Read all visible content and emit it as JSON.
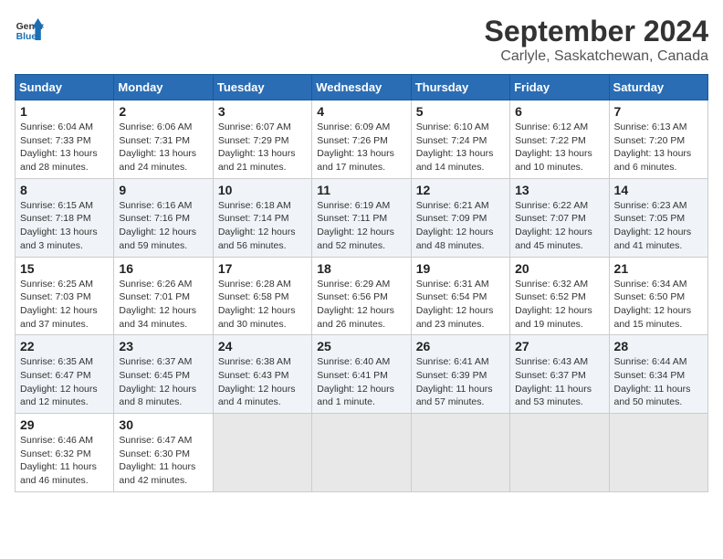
{
  "header": {
    "logo_line1": "General",
    "logo_line2": "Blue",
    "month_year": "September 2024",
    "location": "Carlyle, Saskatchewan, Canada"
  },
  "days_of_week": [
    "Sunday",
    "Monday",
    "Tuesday",
    "Wednesday",
    "Thursday",
    "Friday",
    "Saturday"
  ],
  "weeks": [
    [
      {
        "day": "1",
        "sunrise": "Sunrise: 6:04 AM",
        "sunset": "Sunset: 7:33 PM",
        "daylight": "Daylight: 13 hours and 28 minutes."
      },
      {
        "day": "2",
        "sunrise": "Sunrise: 6:06 AM",
        "sunset": "Sunset: 7:31 PM",
        "daylight": "Daylight: 13 hours and 24 minutes."
      },
      {
        "day": "3",
        "sunrise": "Sunrise: 6:07 AM",
        "sunset": "Sunset: 7:29 PM",
        "daylight": "Daylight: 13 hours and 21 minutes."
      },
      {
        "day": "4",
        "sunrise": "Sunrise: 6:09 AM",
        "sunset": "Sunset: 7:26 PM",
        "daylight": "Daylight: 13 hours and 17 minutes."
      },
      {
        "day": "5",
        "sunrise": "Sunrise: 6:10 AM",
        "sunset": "Sunset: 7:24 PM",
        "daylight": "Daylight: 13 hours and 14 minutes."
      },
      {
        "day": "6",
        "sunrise": "Sunrise: 6:12 AM",
        "sunset": "Sunset: 7:22 PM",
        "daylight": "Daylight: 13 hours and 10 minutes."
      },
      {
        "day": "7",
        "sunrise": "Sunrise: 6:13 AM",
        "sunset": "Sunset: 7:20 PM",
        "daylight": "Daylight: 13 hours and 6 minutes."
      }
    ],
    [
      {
        "day": "8",
        "sunrise": "Sunrise: 6:15 AM",
        "sunset": "Sunset: 7:18 PM",
        "daylight": "Daylight: 13 hours and 3 minutes."
      },
      {
        "day": "9",
        "sunrise": "Sunrise: 6:16 AM",
        "sunset": "Sunset: 7:16 PM",
        "daylight": "Daylight: 12 hours and 59 minutes."
      },
      {
        "day": "10",
        "sunrise": "Sunrise: 6:18 AM",
        "sunset": "Sunset: 7:14 PM",
        "daylight": "Daylight: 12 hours and 56 minutes."
      },
      {
        "day": "11",
        "sunrise": "Sunrise: 6:19 AM",
        "sunset": "Sunset: 7:11 PM",
        "daylight": "Daylight: 12 hours and 52 minutes."
      },
      {
        "day": "12",
        "sunrise": "Sunrise: 6:21 AM",
        "sunset": "Sunset: 7:09 PM",
        "daylight": "Daylight: 12 hours and 48 minutes."
      },
      {
        "day": "13",
        "sunrise": "Sunrise: 6:22 AM",
        "sunset": "Sunset: 7:07 PM",
        "daylight": "Daylight: 12 hours and 45 minutes."
      },
      {
        "day": "14",
        "sunrise": "Sunrise: 6:23 AM",
        "sunset": "Sunset: 7:05 PM",
        "daylight": "Daylight: 12 hours and 41 minutes."
      }
    ],
    [
      {
        "day": "15",
        "sunrise": "Sunrise: 6:25 AM",
        "sunset": "Sunset: 7:03 PM",
        "daylight": "Daylight: 12 hours and 37 minutes."
      },
      {
        "day": "16",
        "sunrise": "Sunrise: 6:26 AM",
        "sunset": "Sunset: 7:01 PM",
        "daylight": "Daylight: 12 hours and 34 minutes."
      },
      {
        "day": "17",
        "sunrise": "Sunrise: 6:28 AM",
        "sunset": "Sunset: 6:58 PM",
        "daylight": "Daylight: 12 hours and 30 minutes."
      },
      {
        "day": "18",
        "sunrise": "Sunrise: 6:29 AM",
        "sunset": "Sunset: 6:56 PM",
        "daylight": "Daylight: 12 hours and 26 minutes."
      },
      {
        "day": "19",
        "sunrise": "Sunrise: 6:31 AM",
        "sunset": "Sunset: 6:54 PM",
        "daylight": "Daylight: 12 hours and 23 minutes."
      },
      {
        "day": "20",
        "sunrise": "Sunrise: 6:32 AM",
        "sunset": "Sunset: 6:52 PM",
        "daylight": "Daylight: 12 hours and 19 minutes."
      },
      {
        "day": "21",
        "sunrise": "Sunrise: 6:34 AM",
        "sunset": "Sunset: 6:50 PM",
        "daylight": "Daylight: 12 hours and 15 minutes."
      }
    ],
    [
      {
        "day": "22",
        "sunrise": "Sunrise: 6:35 AM",
        "sunset": "Sunset: 6:47 PM",
        "daylight": "Daylight: 12 hours and 12 minutes."
      },
      {
        "day": "23",
        "sunrise": "Sunrise: 6:37 AM",
        "sunset": "Sunset: 6:45 PM",
        "daylight": "Daylight: 12 hours and 8 minutes."
      },
      {
        "day": "24",
        "sunrise": "Sunrise: 6:38 AM",
        "sunset": "Sunset: 6:43 PM",
        "daylight": "Daylight: 12 hours and 4 minutes."
      },
      {
        "day": "25",
        "sunrise": "Sunrise: 6:40 AM",
        "sunset": "Sunset: 6:41 PM",
        "daylight": "Daylight: 12 hours and 1 minute."
      },
      {
        "day": "26",
        "sunrise": "Sunrise: 6:41 AM",
        "sunset": "Sunset: 6:39 PM",
        "daylight": "Daylight: 11 hours and 57 minutes."
      },
      {
        "day": "27",
        "sunrise": "Sunrise: 6:43 AM",
        "sunset": "Sunset: 6:37 PM",
        "daylight": "Daylight: 11 hours and 53 minutes."
      },
      {
        "day": "28",
        "sunrise": "Sunrise: 6:44 AM",
        "sunset": "Sunset: 6:34 PM",
        "daylight": "Daylight: 11 hours and 50 minutes."
      }
    ],
    [
      {
        "day": "29",
        "sunrise": "Sunrise: 6:46 AM",
        "sunset": "Sunset: 6:32 PM",
        "daylight": "Daylight: 11 hours and 46 minutes."
      },
      {
        "day": "30",
        "sunrise": "Sunrise: 6:47 AM",
        "sunset": "Sunset: 6:30 PM",
        "daylight": "Daylight: 11 hours and 42 minutes."
      },
      null,
      null,
      null,
      null,
      null
    ]
  ]
}
